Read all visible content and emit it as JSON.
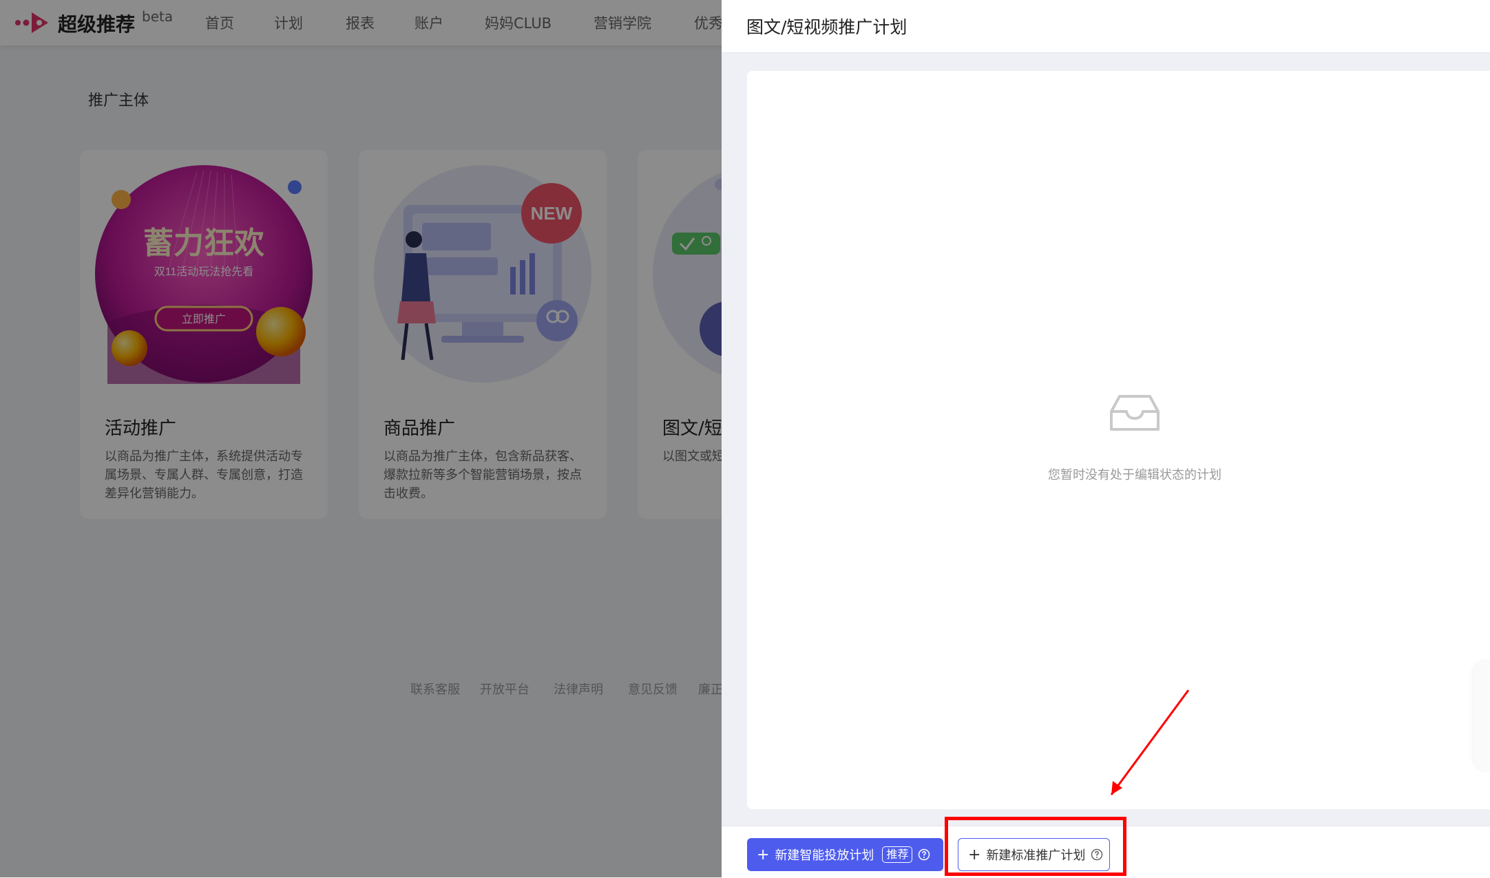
{
  "app": {
    "logo_text": "超级推荐",
    "beta_label": "beta",
    "nav": [
      "首页",
      "计划",
      "报表",
      "账户",
      "妈妈CLUB",
      "营销学院",
      "优秀"
    ]
  },
  "main": {
    "section_title": "推广主体",
    "cards": [
      {
        "title": "活动推广",
        "desc": "以商品为推广主体，系统提供活动专属场景、专属人群、专属创意，打造差异化营销能力。",
        "banner_title": "蓄力狂欢",
        "banner_subtitle": "双11活动玩法抢先看",
        "banner_button": "立即推广"
      },
      {
        "title": "商品推广",
        "desc": "以商品为推广主体，包含新品获客、爆款拉新等多个智能营销场景，按点击收费。",
        "badge": "NEW"
      },
      {
        "title": "图文/短视",
        "desc": "以图文或短广，将内容点击收费。"
      }
    ],
    "footer_links": [
      "联系客服",
      "开放平台",
      "法律声明",
      "意见反馈",
      "廉正"
    ]
  },
  "drawer": {
    "title": "图文/短视频推广计划",
    "empty_text": "您暂时没有处于编辑状态的计划",
    "primary_button": "新建智能投放计划",
    "primary_badge": "推荐",
    "secondary_button": "新建标准推广计划",
    "plus": "+"
  },
  "colors": {
    "accent": "#4d5ced",
    "highlight": "#ff0000"
  }
}
